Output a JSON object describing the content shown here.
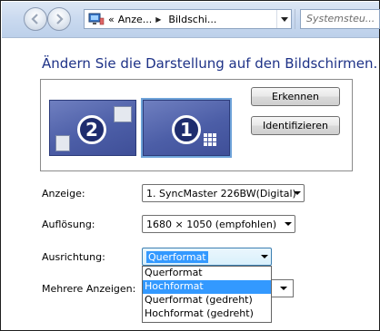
{
  "addressbar": {
    "prefix": "«",
    "crumb1": "Anze...",
    "crumb2": "Bildschi...",
    "search_placeholder": "Systemsteu..."
  },
  "heading": "Ändern Sie die Darstellung auf den Bildschirmen.",
  "monitors": [
    {
      "number": "2"
    },
    {
      "number": "1"
    }
  ],
  "buttons": {
    "erkennen": "Erkennen",
    "identifizieren": "Identifizieren"
  },
  "fields": {
    "anzeige_label": "Anzeige:",
    "anzeige_value": "1. SyncMaster 226BW(Digital)",
    "aufloesung_label": "Auflösung:",
    "aufloesung_value": "1680 × 1050 (empfohlen)",
    "ausrichtung_label": "Ausrichtung:",
    "ausrichtung_value": "Querformat",
    "mehrere_label": "Mehrere Anzeigen:"
  },
  "ausrichtung_options": [
    {
      "label": "Querformat",
      "selected": false
    },
    {
      "label": "Hochformat",
      "selected": true
    },
    {
      "label": "Querformat (gedreht)",
      "selected": false
    },
    {
      "label": "Hochformat (gedreht)",
      "selected": false
    }
  ],
  "colors": {
    "heading": "#1e3287",
    "highlight": "#3399ff",
    "monitor": "#4c5ea7"
  }
}
